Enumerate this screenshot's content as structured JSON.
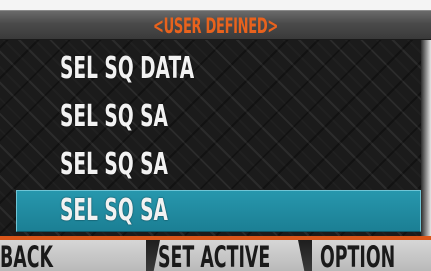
{
  "header": {
    "title": "<USER DEFINED>"
  },
  "menu": {
    "items": [
      {
        "label": "SEL SQ DATA",
        "selected": false
      },
      {
        "label": "SEL SQ SA",
        "selected": false
      },
      {
        "label": "SEL SQ SA",
        "selected": false
      },
      {
        "label": "SEL SQ SA",
        "selected": true
      }
    ]
  },
  "softkeys": {
    "back": "BACK",
    "set_active": "SET ACTIVE",
    "option": "OPTION"
  },
  "colors": {
    "accent_orange": "#e8621d",
    "selection_teal": "#2797ad",
    "text_white": "#f2f2f2"
  }
}
